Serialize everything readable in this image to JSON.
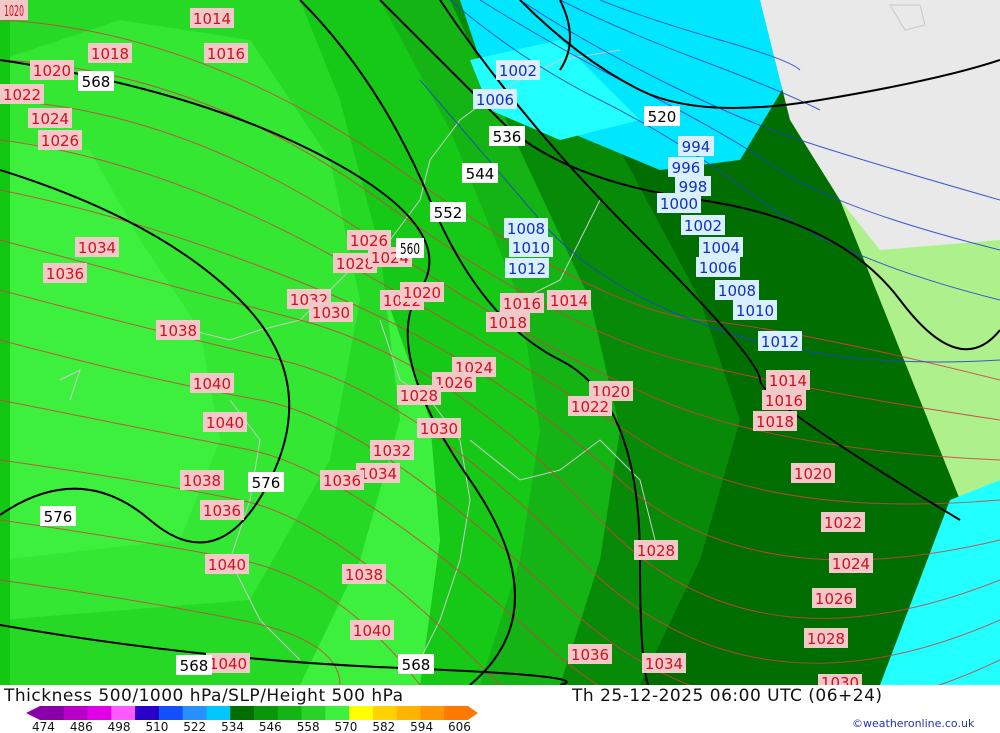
{
  "title": "Thickness 500/1000 hPa/SLP/Height 500 hPa",
  "valid_time": "Th 25-12-2025 06:00 UTC (06+24)",
  "credit": "©weatheronline.co.uk",
  "colors": {
    "land": "#e9e9e9",
    "light_green": "#aef08c",
    "green_546": "#14b414",
    "green_552": "#0fa00f",
    "green_558": "#16c916",
    "green_564": "#25d925",
    "green_570": "#3ef03e",
    "green_540": "#078a07",
    "green_534": "#006e00",
    "cyan_522": "#00e6ff",
    "cyan_528": "#22ffff",
    "slp_line": "#d04040",
    "slp_low_line": "#2040d0",
    "height_line": "#000000",
    "coast": "#c8c8c8"
  },
  "scale": {
    "labels": [
      "474",
      "486",
      "498",
      "510",
      "522",
      "534",
      "546",
      "558",
      "570",
      "582",
      "594",
      "606"
    ],
    "colors": [
      "#8a00a8",
      "#b800c8",
      "#e000e6",
      "#ff5aff",
      "#2a00c8",
      "#1450ff",
      "#2890ff",
      "#00c8ff",
      "#006e00",
      "#0a960a",
      "#14b414",
      "#28d228",
      "#40f040",
      "#ffff00",
      "#ffd200",
      "#ffb400",
      "#ff9600",
      "#ff7800"
    ]
  },
  "slp_labels": [
    {
      "text": "1014",
      "c": "r"
    },
    {
      "text": "1016",
      "c": "r"
    },
    {
      "text": "1018",
      "c": "r"
    },
    {
      "text": "1020",
      "c": "r"
    },
    {
      "text": "1022",
      "c": "r"
    },
    {
      "text": "1024",
      "c": "r"
    },
    {
      "text": "1026",
      "c": "r"
    },
    {
      "text": "1034",
      "c": "r"
    },
    {
      "text": "1036",
      "c": "r"
    },
    {
      "text": "1038",
      "c": "r"
    },
    {
      "text": "1040",
      "c": "r"
    },
    {
      "text": "1040",
      "c": "r"
    },
    {
      "text": "1038",
      "c": "r"
    },
    {
      "text": "1036",
      "c": "r"
    },
    {
      "text": "1040",
      "c": "r"
    },
    {
      "text": "1032",
      "c": "r"
    },
    {
      "text": "1030",
      "c": "r"
    },
    {
      "text": "1026",
      "c": "r"
    },
    {
      "text": "1028",
      "c": "r"
    },
    {
      "text": "1024",
      "c": "r"
    },
    {
      "text": "1022",
      "c": "r"
    },
    {
      "text": "1020",
      "c": "r"
    },
    {
      "text": "1018",
      "c": "r"
    },
    {
      "text": "1016",
      "c": "r"
    },
    {
      "text": "1014",
      "c": "r"
    },
    {
      "text": "1024",
      "c": "r"
    },
    {
      "text": "1026",
      "c": "r"
    },
    {
      "text": "1028",
      "c": "r"
    },
    {
      "text": "1030",
      "c": "r"
    },
    {
      "text": "1032",
      "c": "r"
    },
    {
      "text": "1034",
      "c": "r"
    },
    {
      "text": "1036",
      "c": "r"
    },
    {
      "text": "1038",
      "c": "r"
    },
    {
      "text": "1040",
      "c": "r"
    },
    {
      "text": "1020",
      "c": "r"
    },
    {
      "text": "1022",
      "c": "r"
    },
    {
      "text": "1014",
      "c": "r"
    },
    {
      "text": "1016",
      "c": "r"
    },
    {
      "text": "1018",
      "c": "r"
    },
    {
      "text": "1020",
      "c": "r"
    },
    {
      "text": "1022",
      "c": "r"
    },
    {
      "text": "1024",
      "c": "r"
    },
    {
      "text": "1026",
      "c": "r"
    },
    {
      "text": "1028",
      "c": "r"
    },
    {
      "text": "1028",
      "c": "r"
    },
    {
      "text": "1036",
      "c": "r"
    },
    {
      "text": "1034",
      "c": "r"
    },
    {
      "text": "1030",
      "c": "r"
    },
    {
      "text": "1020",
      "c": "r"
    },
    {
      "text": "1040",
      "c": "r"
    }
  ],
  "slp_low_labels": [
    "1002",
    "1006",
    "994",
    "996",
    "998",
    "1000",
    "1002",
    "1004",
    "1006",
    "1008",
    "1010",
    "1012",
    "1008",
    "1010",
    "1012"
  ],
  "height_labels": [
    "568",
    "536",
    "544",
    "552",
    "520",
    "576",
    "576",
    "568",
    "568",
    "560"
  ]
}
